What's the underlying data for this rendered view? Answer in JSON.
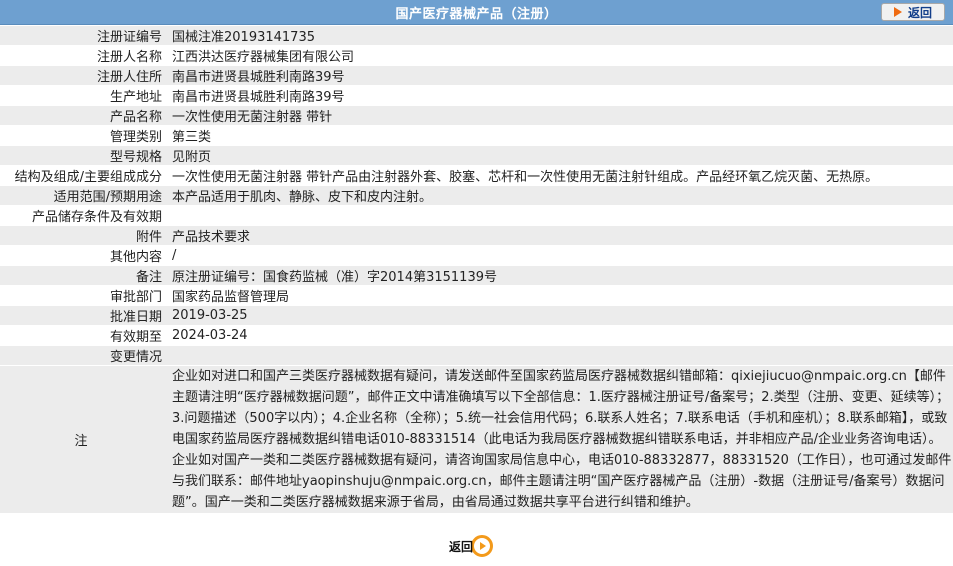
{
  "header": {
    "title": "国产医疗器械产品（注册）",
    "back_label": "返回"
  },
  "rows": [
    {
      "label": "注册证编号",
      "value": "国械注准20193141735"
    },
    {
      "label": "注册人名称",
      "value": "江西洪达医疗器械集团有限公司"
    },
    {
      "label": "注册人住所",
      "value": "南昌市进贤县城胜利南路39号"
    },
    {
      "label": "生产地址",
      "value": "南昌市进贤县城胜利南路39号"
    },
    {
      "label": "产品名称",
      "value": "一次性使用无菌注射器 带针"
    },
    {
      "label": "管理类别",
      "value": "第三类"
    },
    {
      "label": "型号规格",
      "value": "见附页"
    },
    {
      "label": "结构及组成/主要组成成分",
      "value": "一次性使用无菌注射器 带针产品由注射器外套、胶塞、芯杆和一次性使用无菌注射针组成。产品经环氧乙烷灭菌、无热原。"
    },
    {
      "label": "适用范围/预期用途",
      "value": "本产品适用于肌肉、静脉、皮下和皮内注射。"
    },
    {
      "label": "产品储存条件及有效期",
      "value": ""
    },
    {
      "label": "附件",
      "value": "产品技术要求"
    },
    {
      "label": "其他内容",
      "value": "/"
    },
    {
      "label": "备注",
      "value": "原注册证编号：国食药监械（准）字2014第3151139号"
    },
    {
      "label": "审批部门",
      "value": "国家药品监督管理局"
    },
    {
      "label": "批准日期",
      "value": "2019-03-25"
    },
    {
      "label": "有效期至",
      "value": "2024-03-24"
    },
    {
      "label": "变更情况",
      "value": ""
    }
  ],
  "note": {
    "label": "注",
    "text": "企业如对进口和国产三类医疗器械数据有疑问，请发送邮件至国家药监局医疗器械数据纠错邮箱：qixiejiucuo@nmpaic.org.cn【邮件主题请注明“医疗器械数据问题”，邮件正文中请准确填写以下全部信息：1.医疗器械注册证号/备案号；2.类型（注册、变更、延续等）；3.问题描述（500字以内）；4.企业名称（全称）；5.统一社会信用代码；6.联系人姓名；7.联系电话（手机和座机）；8.联系邮箱】，或致电国家药监局医疗器械数据纠错电话010-88331514（此电话为我局医疗器械数据纠错联系电话，并非相应产品/企业业务咨询电话）。企业如对国产一类和二类医疗器械数据有疑问，请咨询国家局信息中心，电话010-88332877，88331520（工作日），也可通过发邮件与我们联系：邮件地址yaopinshuju@nmpaic.org.cn，邮件主题请注明“国产医疗器械产品（注册）-数据（注册证号/备案号）数据问题”。国产一类和二类医疗器械数据来源于省局，由省局通过数据共享平台进行纠错和维护。"
  },
  "footer": {
    "back_label": "返回"
  },
  "colors": {
    "header_bg": "#6ea0d0",
    "row_shade": "#ececec",
    "back_arrow": "#ef6b12",
    "back_ring": "#f39a1b"
  }
}
